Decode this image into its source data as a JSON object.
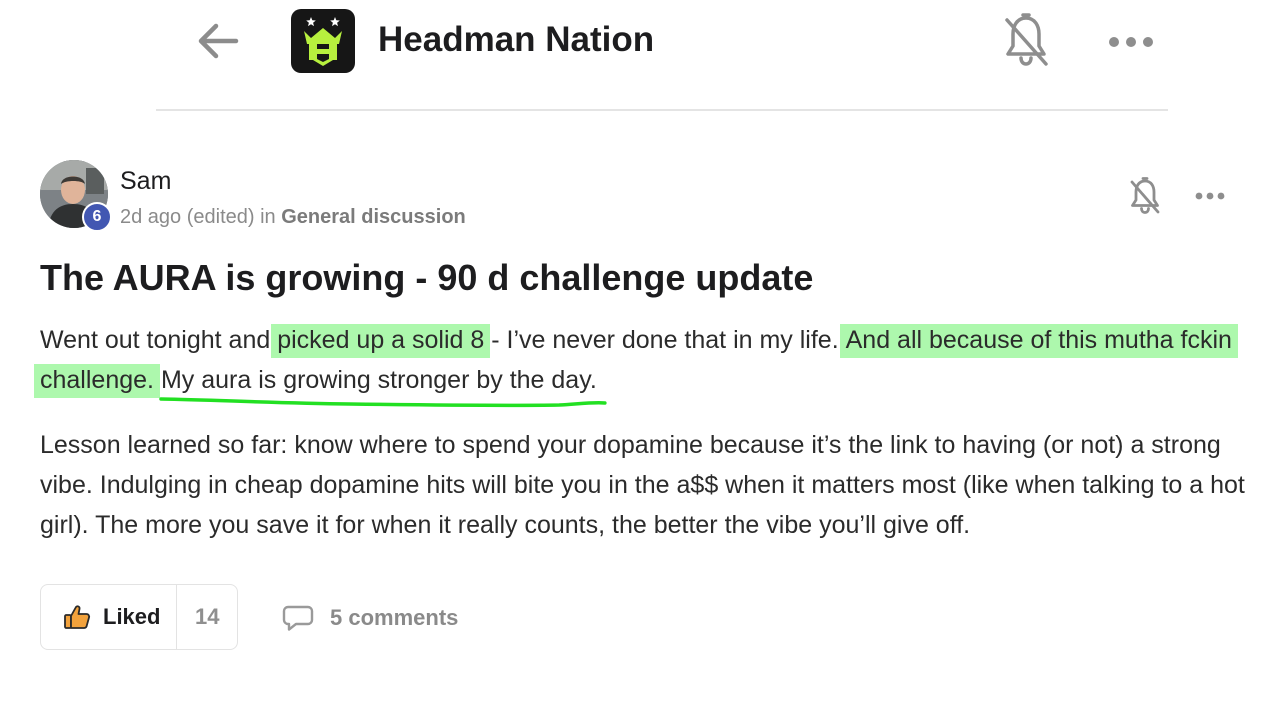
{
  "header": {
    "back_icon": "arrow-left-icon",
    "group_name": "Headman Nation",
    "notification_icon": "bell-off-icon",
    "more_icon": "more-horizontal-icon"
  },
  "post": {
    "author": "Sam",
    "level": "6",
    "meta_prefix": "2d ago (edited) in",
    "category": "General discussion",
    "title": "The AURA is growing - 90 d challenge update",
    "body_p1": {
      "s1": "Went out tonight and",
      "hl1": "picked up a solid 8",
      "s2": "- I’ve never done that in my life.",
      "hl2": "And all because of this mutha fckin challenge.",
      "underlined": "My aura is growing stronger by the day."
    },
    "body_p2": "Lesson learned so far: know where to spend your dopamine because it’s the link to having (or not) a strong vibe. Indulging in cheap dopamine hits will bite you in the a$$ when it matters most (like when talking to a hot girl). The more you save it for when it really counts, the better the vibe you’ll give off."
  },
  "actions": {
    "like_label": "Liked",
    "like_count": "14",
    "comments_label": "5 comments",
    "like_icon": "thumbs-up-icon",
    "comment_icon": "comment-icon"
  },
  "colors": {
    "highlight": "#adf8ad",
    "underline": "#22e022",
    "badge": "#4257b2",
    "like_icon": "#f2a23c"
  }
}
